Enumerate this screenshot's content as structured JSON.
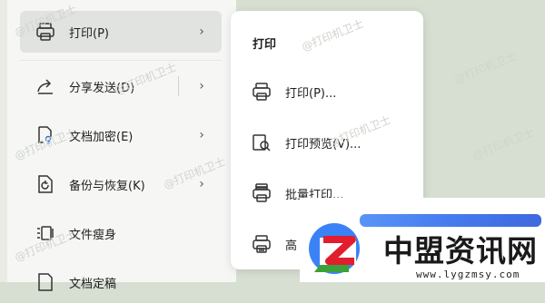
{
  "left_menu": {
    "items": [
      {
        "label": "打印(P)",
        "icon": "printer-icon",
        "has_submenu": true,
        "active": true
      },
      {
        "label": "分享发送(D)",
        "icon": "share-icon",
        "has_submenu": true
      },
      {
        "label": "文档加密(E)",
        "icon": "document-lock-icon",
        "has_submenu": true
      },
      {
        "label": "备份与恢复(K)",
        "icon": "backup-icon",
        "has_submenu": true
      },
      {
        "label": "文件瘦身",
        "icon": "file-compress-icon",
        "has_submenu": false
      },
      {
        "label": "文档定稿",
        "icon": "document-finalize-icon",
        "has_submenu": false
      }
    ]
  },
  "submenu": {
    "title": "打印",
    "items": [
      {
        "label": "打印(P)...",
        "icon": "printer-icon"
      },
      {
        "label": "打印预览(V)...",
        "icon": "print-preview-icon"
      },
      {
        "label": "批量打印...",
        "icon": "batch-print-icon"
      },
      {
        "label": "高",
        "icon": "printer-advanced-icon"
      }
    ]
  },
  "watermark": {
    "text": "@打印机卫士"
  },
  "logo": {
    "name": "中盟资讯网",
    "url": "www.lygzmsy.com"
  },
  "colors": {
    "background": "#d7dfd2",
    "panel": "#f6f7f5",
    "active_item": "#e1e3e1",
    "logo_blue": "#2563eb",
    "logo_red": "#e11d2e",
    "logo_green": "#3ba13b"
  }
}
